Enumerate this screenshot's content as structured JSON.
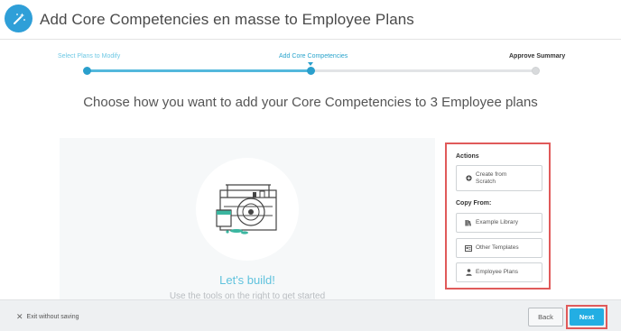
{
  "header": {
    "title": "Add Core Competencies en masse to Employee Plans",
    "icon": "magic-wand-icon"
  },
  "stepper": {
    "steps": [
      {
        "label": "Select Plans to Modify",
        "state": "done"
      },
      {
        "label": "Add Core Competencies",
        "state": "active"
      },
      {
        "label": "Approve Summary",
        "state": "todo"
      }
    ]
  },
  "main": {
    "heading": "Choose how you want to add your Core Competencies to 3 Employee plans",
    "build_title": "Let's build!",
    "build_subtitle": "Use the tools on the right to get started"
  },
  "actions": {
    "title": "Actions",
    "create_from_scratch": "Create from Scratch",
    "copy_from_title": "Copy From:",
    "example_library": "Example Library",
    "other_templates": "Other Templates",
    "employee_plans": "Employee Plans"
  },
  "footer": {
    "exit_label": "Exit without saving",
    "back_label": "Back",
    "next_label": "Next"
  },
  "colors": {
    "accent": "#2f9fd8",
    "primary_button": "#23aee3",
    "highlight_outline": "#e05a5a",
    "progress_done": "#53b8dc",
    "progress_todo": "#e2e4e6"
  }
}
